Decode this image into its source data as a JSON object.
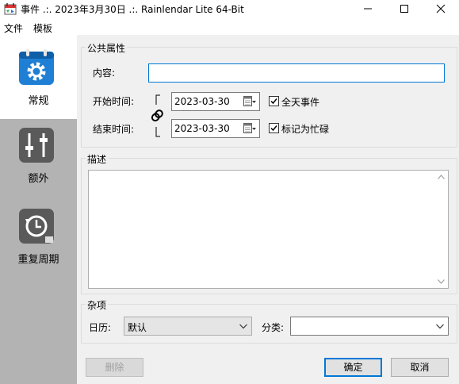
{
  "window": {
    "title": "事件 .:. 2023年3月30日 .:. Rainlendar Lite 64-Bit"
  },
  "menu": {
    "items": [
      "文件",
      "模板"
    ]
  },
  "sidebar": {
    "items": [
      {
        "label": "常规",
        "icon": "gear-calendar-icon"
      },
      {
        "label": "额外",
        "icon": "sliders-icon"
      },
      {
        "label": "重复周期",
        "icon": "recurrence-clock-icon"
      }
    ]
  },
  "general": {
    "group_title": "公共属性",
    "content_label": "内容:",
    "content_value": "",
    "start_label": "开始时间:",
    "start_date": "2023-03-30",
    "end_label": "结束时间:",
    "end_date": "2023-03-30",
    "allday_label": "全天事件",
    "allday_checked": true,
    "busy_label": "标记为忙碌",
    "busy_checked": true
  },
  "description": {
    "group_title": "描述",
    "value": ""
  },
  "misc": {
    "group_title": "杂项",
    "calendar_label": "日历:",
    "calendar_value": "默认",
    "category_label": "分类:",
    "category_value": ""
  },
  "buttons": {
    "delete": "删除",
    "ok": "确定",
    "cancel": "取消"
  },
  "colors": {
    "accent": "#0078d7",
    "sidebar_bg": "#b3b3b3",
    "panel_bg": "#f0f0f0"
  }
}
